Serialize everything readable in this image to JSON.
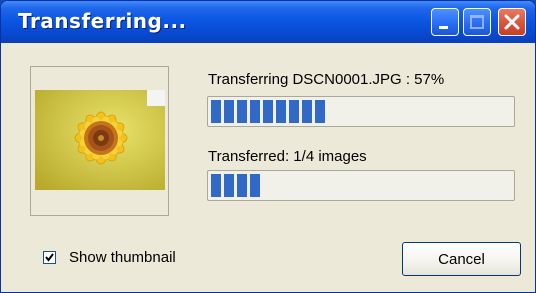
{
  "window": {
    "title": "Transferring..."
  },
  "status": {
    "file_text": "Transferring DSCN0001.JPG : 57%",
    "file_progress": 0.57,
    "count_text": "Transferred: 1/4 images",
    "count_progress": 0.25
  },
  "thumbnail": {
    "icon": "sunflower-photo"
  },
  "controls": {
    "show_thumbnail_label": "Show thumbnail",
    "show_thumbnail_checked": true,
    "cancel_label": "Cancel"
  },
  "colors": {
    "titlebar": "#0b57e4",
    "progress_fill": "#3169c6",
    "dialog_bg": "#ece9d8"
  }
}
